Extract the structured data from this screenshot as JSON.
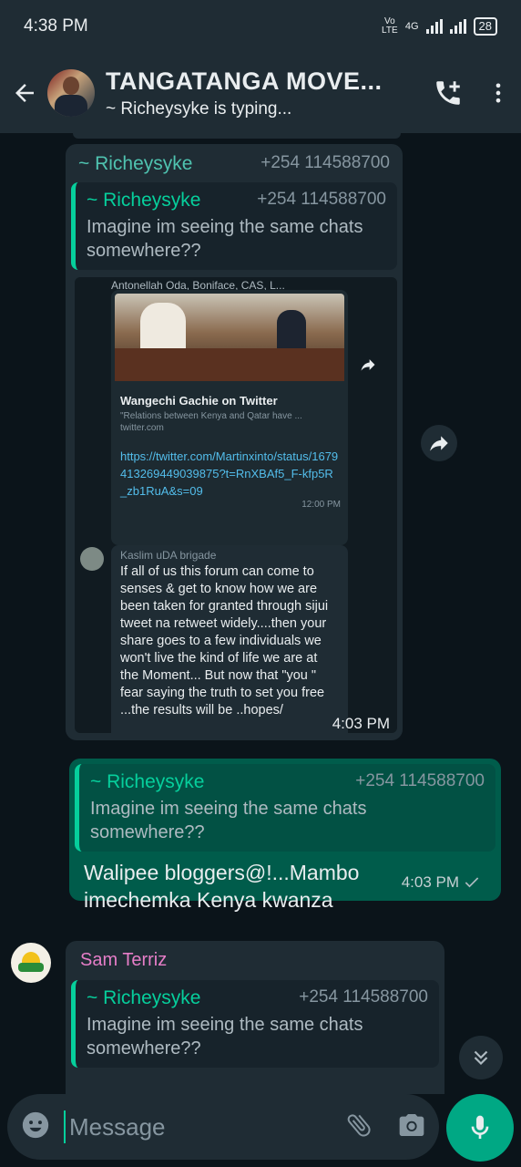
{
  "status_bar": {
    "time": "4:38 PM",
    "network": "Vo LTE",
    "network_type": "4G",
    "battery": "28"
  },
  "header": {
    "title": "TANGATANGA MOVE...",
    "subtitle": "~ Richeysyke is typing..."
  },
  "messages": {
    "forwarded_block": {
      "sender": "~ Richeysyke",
      "phone": "+254 114588700",
      "quote_sender": "~ Richeysyke",
      "quote_phone": "+254 114588700",
      "quote_text": "Imagine im seeing the same chats somewhere??",
      "inner_header": "Antonellah Oda, Boniface, CAS, L...",
      "link_title": "Wangechi Gachie on Twitter",
      "link_desc": "\"Relations between Kenya and Qatar have ...",
      "link_domain": "twitter.com",
      "link_url": "https://twitter.com/Martinxinto/status/1679413269449039875?t=RnXBAf5_F-kfp5R_zb1RuA&s=09",
      "link_time": "12:00 PM",
      "inner_sender": "Kaslim uDA brigade",
      "inner_text": "If all of us this forum can come to senses & get to know how we are been taken for granted through sijui tweet na retweet widely....then your share goes to a few individuals we won't live the kind of life we are at the Moment... But now that \"you \" fear saying the truth to set you free ...the results will be ..hopes/",
      "time": "4:03 PM"
    },
    "outgoing": {
      "quote_sender": "~ Richeysyke",
      "quote_phone": "+254 114588700",
      "quote_text": "Imagine im seeing the same chats somewhere??",
      "text": "Walipee bloggers@!...Mambo imechemka Kenya kwanza",
      "time": "4:03 PM",
      "status": "sent"
    },
    "incoming_last": {
      "sender": "Sam Terriz",
      "quote_sender": "~ Richeysyke",
      "quote_phone": "+254 114588700",
      "quote_text": "Imagine im seeing the same chats somewhere??"
    }
  },
  "input": {
    "placeholder": "Message"
  },
  "colors": {
    "accent": "#00a884",
    "outgoing_bubble": "#005c4b",
    "incoming_bubble": "#1f2c34",
    "sender_green": "#06cf9c",
    "sender_pink": "#e67ec8"
  }
}
